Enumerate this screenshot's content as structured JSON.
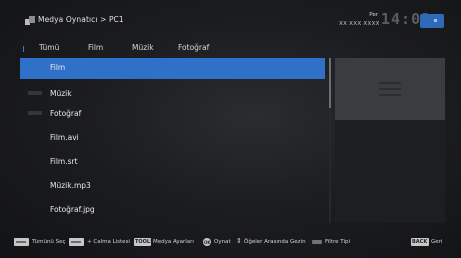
{
  "header": {
    "breadcrumb": "Medya Oynatıcı > PC1",
    "day": "Per",
    "date": "XX XXX XXXX",
    "clock": "14:03"
  },
  "tabs": [
    {
      "label": "Tümü"
    },
    {
      "label": "Film"
    },
    {
      "label": "Müzik"
    },
    {
      "label": "Fotoğraf"
    }
  ],
  "list": [
    {
      "label": "Film",
      "selected": true
    },
    {
      "label": "Müzik"
    },
    {
      "label": "Fotoğraf"
    },
    {
      "label": "Film.avi"
    },
    {
      "label": "Film.srt"
    },
    {
      "label": "Müzik.mp3"
    },
    {
      "label": "Fotoğraf.jpg"
    }
  ],
  "footer": {
    "select_all": "Tümünü Seç",
    "playlist": "+ Calma Listesi",
    "tools_key": "TOOLS",
    "media_settings": "Medya Ayarları",
    "ok_key": "OK",
    "play": "Oynat",
    "navigate": "Öğeler Arasında Gezin",
    "filter_type": "Filtre Tipi",
    "back_key": "BACK",
    "back": "Geri"
  },
  "colors": {
    "accent": "#2f70c8",
    "background": "#1c1d20"
  },
  "icons": [
    "media-player-icon",
    "tv-icon",
    "filter-icon",
    "navigate-icon"
  ]
}
